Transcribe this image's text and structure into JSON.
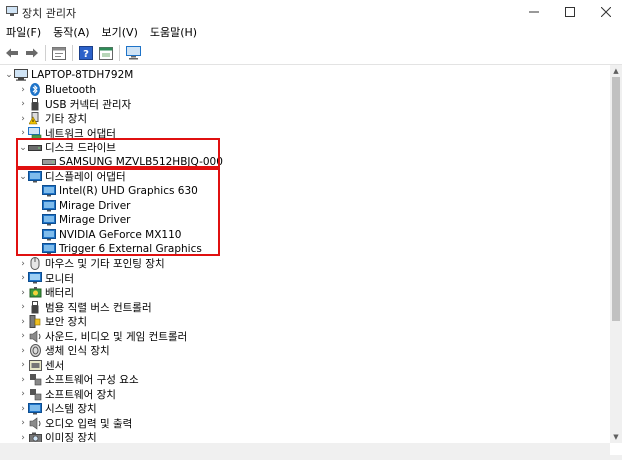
{
  "window": {
    "title": "장치 관리자"
  },
  "menu": [
    "파일(F)",
    "동작(A)",
    "보기(V)",
    "도움말(H)"
  ],
  "tree": {
    "root": "LAPTOP-8TDH792M",
    "items": [
      {
        "label": "Bluetooth",
        "icon": "bluetooth-icon",
        "expanded": false
      },
      {
        "label": "USB 커넥터 관리자",
        "icon": "usb-icon",
        "expanded": false
      },
      {
        "label": "기타 장치",
        "icon": "unknown-device-icon",
        "expanded": false
      },
      {
        "label": "네트워크 어댑터",
        "icon": "network-adapter-icon",
        "expanded": false
      },
      {
        "label": "디스크 드라이브",
        "icon": "disk-drive-icon",
        "expanded": true,
        "children": [
          "SAMSUNG MZVLB512HBJQ-000"
        ]
      },
      {
        "label": "디스플레이 어댑터",
        "icon": "display-adapter-icon",
        "expanded": true,
        "children": [
          "Intel(R) UHD Graphics 630",
          "Mirage Driver",
          "Mirage Driver",
          "NVIDIA GeForce MX110",
          "Trigger 6 External Graphics"
        ]
      },
      {
        "label": "마우스 및 기타 포인팅 장치",
        "icon": "mouse-icon",
        "expanded": false
      },
      {
        "label": "모니터",
        "icon": "monitor-icon",
        "expanded": false
      },
      {
        "label": "배터리",
        "icon": "battery-icon",
        "expanded": false
      },
      {
        "label": "범용 직렬 버스 컨트롤러",
        "icon": "usb-controller-icon",
        "expanded": false
      },
      {
        "label": "보안 장치",
        "icon": "security-device-icon",
        "expanded": false
      },
      {
        "label": "사운드, 비디오 및 게임 컨트롤러",
        "icon": "sound-icon",
        "expanded": false
      },
      {
        "label": "생체 인식 장치",
        "icon": "biometric-icon",
        "expanded": false
      },
      {
        "label": "센서",
        "icon": "sensor-icon",
        "expanded": false
      },
      {
        "label": "소프트웨어 구성 요소",
        "icon": "software-component-icon",
        "expanded": false
      },
      {
        "label": "소프트웨어 장치",
        "icon": "software-device-icon",
        "expanded": false
      },
      {
        "label": "시스템 장치",
        "icon": "system-device-icon",
        "expanded": false
      },
      {
        "label": "오디오 입력 및 출력",
        "icon": "audio-io-icon",
        "expanded": false
      },
      {
        "label": "이미징 장치",
        "icon": "imaging-icon",
        "expanded": false
      }
    ]
  },
  "colors": {
    "highlight": "#e01010",
    "monitor_blue": "#1e73c8",
    "chevron": "#555555"
  }
}
